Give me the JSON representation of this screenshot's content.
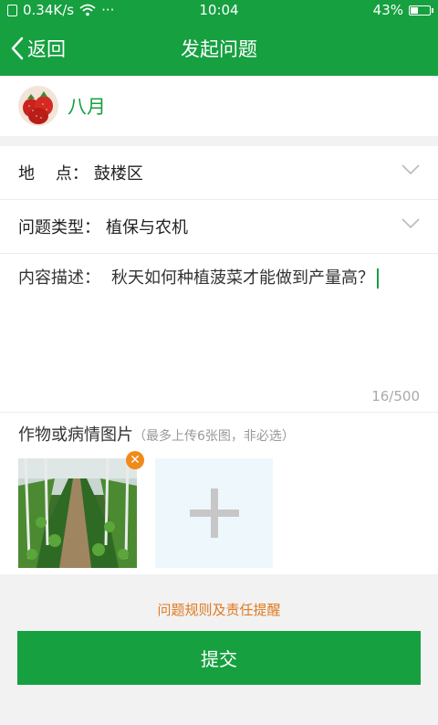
{
  "status": {
    "network": "0.34K/s",
    "more": "···",
    "time": "10:04",
    "battery_pct": "43%",
    "battery_level": 0.43
  },
  "nav": {
    "back_label": "返回",
    "title": "发起问题"
  },
  "user": {
    "name": "八月"
  },
  "form": {
    "location_label": "地    点：",
    "location_value": "鼓楼区",
    "type_label": "问题类型：",
    "type_value": "植保与农机",
    "desc_label": "内容描述：",
    "desc_value": "秋天如何种植菠菜才能做到产量高？",
    "counter": "16/500"
  },
  "photos": {
    "title": "作物或病情图片",
    "hint": "（最多上传6张图，非必选）"
  },
  "footer": {
    "rules_link": "问题规则及责任提醒",
    "submit_label": "提交"
  },
  "colors": {
    "brand": "#16a040",
    "accent": "#f08a18"
  }
}
